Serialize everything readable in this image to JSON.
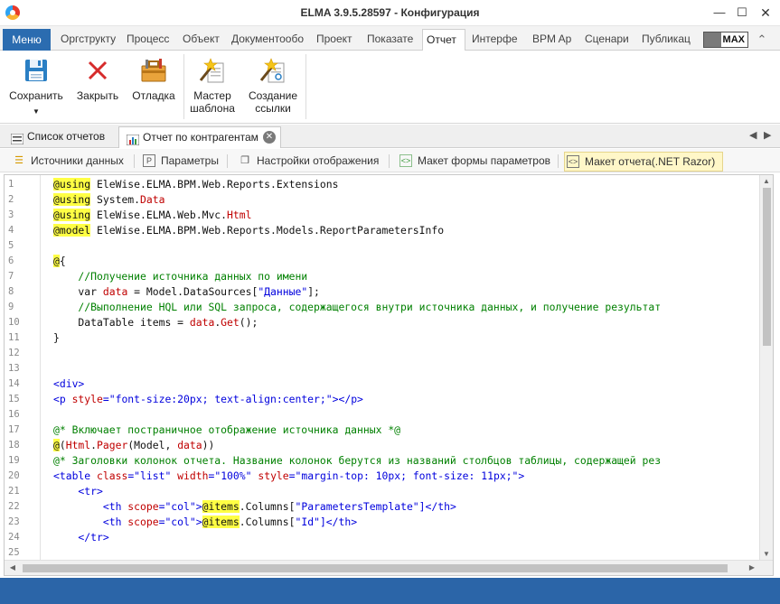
{
  "window": {
    "title": "ELMA 3.9.5.28597 - Конфигурация",
    "minimize_icon": "minimize-icon",
    "maximize_icon": "maximize-icon",
    "close_icon": "close-icon"
  },
  "ribbon_tabs": {
    "menu_label": "Меню",
    "items": [
      "Оргструкту",
      "Процесс",
      "Объект",
      "Документообо",
      "Проект",
      "Показате",
      "Отчет",
      "Интерфе",
      "BPM Ap",
      "Сценари",
      "Публикац"
    ],
    "active_index": 6,
    "max_label": "MAX"
  },
  "ribbon": {
    "save": "Сохранить",
    "close": "Закрыть",
    "debug": "Отладка",
    "template_master": "Мастер шаблона",
    "create_link": "Создание ссылки"
  },
  "doc_tabs": {
    "reports_list": "Список отчетов",
    "report": "Отчет по контрагентам"
  },
  "sub_tabs": {
    "data_sources": "Источники данных",
    "parameters": "Параметры",
    "display_settings": "Настройки отображения",
    "params_form_layout": "Макет формы параметров",
    "report_layout": "Макет отчета(.NET Razor)"
  },
  "editor": {
    "line_numbers": [
      "1",
      "2",
      "3",
      "4",
      "5",
      "6",
      "7",
      "8",
      "9",
      "10",
      "11",
      "12",
      "13",
      "14",
      "15",
      "16",
      "17",
      "18",
      "19",
      "20",
      "21",
      "22",
      "23",
      "24",
      "25"
    ]
  },
  "code": {
    "l1_kw": "@using",
    "l1_rest": " EleWise.ELMA.BPM.Web.Reports.Extensions",
    "l2_kw": "@using",
    "l2_a": " System.",
    "l2_b": "Data",
    "l3_kw": "@using",
    "l3_a": " EleWise.ELMA.Web.Mvc.",
    "l3_b": "Html",
    "l4_kw": "@model",
    "l4_rest": " EleWise.ELMA.BPM.Web.Reports.Models.ReportParametersInfo",
    "l6_kw": "@",
    "l6_rest": "{",
    "l7": "    //Получение источника данных по имени",
    "l8_a": "    var ",
    "l8_b": "data",
    "l8_c": " = Model.DataSources[",
    "l8_d": "\"Данные\"",
    "l8_e": "];",
    "l9": "    //Выполнение HQL или SQL запроса, содержащегося внутри источника данных, и получение результат",
    "l10_a": "    DataTable items = ",
    "l10_b": "data",
    "l10_c": ".",
    "l10_d": "Get",
    "l10_e": "();",
    "l11": "}",
    "l14": "<div>",
    "l15_a": "<p ",
    "l15_b": "style",
    "l15_c": "=",
    "l15_d": "\"font-size:20px; text-align:center;\"",
    "l15_e": "></p>",
    "l17": "@* Включает постраничное отображение источника данных *@",
    "l18_kw": "@",
    "l18_a": "(",
    "l18_b": "Html",
    "l18_c": ".",
    "l18_d": "Pager",
    "l18_e": "(Model, ",
    "l18_f": "data",
    "l18_g": "))",
    "l19": "@* Заголовки колонок отчета. Название колонок берутся из названий столбцов таблицы, содержащей рез",
    "l20_a": "<table ",
    "l20_b": "class",
    "l20_c": "=",
    "l20_d": "\"list\"",
    "l20_e": " width",
    "l20_f": "=",
    "l20_g": "\"100%\"",
    "l20_h": " style",
    "l20_i": "=",
    "l20_j": "\"margin-top: 10px; font-size: 11px;\"",
    "l20_k": ">",
    "l21": "    <tr>",
    "l22_a": "        <th ",
    "l22_b": "scope",
    "l22_c": "=",
    "l22_d": "\"col\"",
    "l22_e": ">",
    "l22_kw": "@items",
    "l22_f": ".Columns[",
    "l22_g": "\"ParametersTemplate\"",
    "l22_h": "]</th>",
    "l23_a": "        <th ",
    "l23_b": "scope",
    "l23_c": "=",
    "l23_d": "\"col\"",
    "l23_e": ">",
    "l23_kw": "@items",
    "l23_f": ".Columns[",
    "l23_g": "\"Id\"",
    "l23_h": "]</th>",
    "l24": "    </tr>"
  }
}
